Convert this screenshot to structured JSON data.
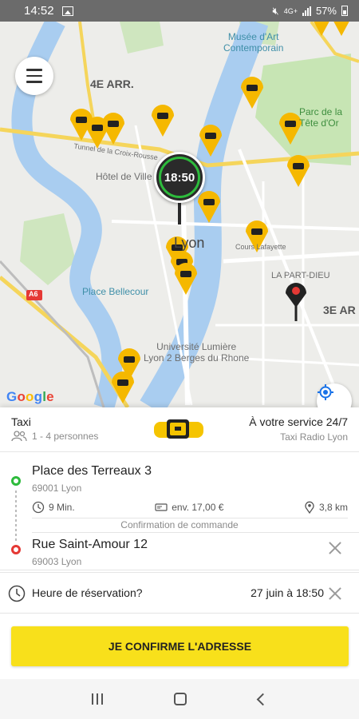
{
  "status_bar": {
    "time": "14:52",
    "battery": "57%",
    "network": "4G+"
  },
  "map": {
    "labels": {
      "arr4": "4E ARR.",
      "arr3": "3E AR",
      "musee": "Musée d'Art\nContemporain",
      "parc": "Parc de la\nTête d'Or",
      "lyon": "Lyon",
      "hotel": "Hôtel de Ville de Lyon",
      "bellecour": "Place Bellecour",
      "partdieu": "LA PART-DIEU",
      "univ": "Université Lumière\nLyon 2 Berges du Rhone",
      "lafayette": "Cours Lafayette",
      "a6": "A6",
      "croix": "Tunnel de la Croix-Rousse"
    },
    "pickup_time": "18:50",
    "attribution": "Google"
  },
  "vehicle": {
    "type": "Taxi",
    "capacity": "1 - 4 personnes",
    "service": "À votre service 24/7",
    "company": "Taxi Radio Lyon"
  },
  "route": {
    "origin": {
      "address": "Place des Terreaux 3",
      "city": "69001 Lyon"
    },
    "destination": {
      "address": "Rue Saint-Amour 12",
      "city": "69003 Lyon"
    },
    "duration": "9 Min.",
    "price": "env. 17,00 €",
    "distance": "3,8 km",
    "confirmation_note": "Confirmation de commande"
  },
  "reservation": {
    "label": "Heure de réservation?",
    "value": "27 juin à 18:50"
  },
  "cta": {
    "label": "JE CONFIRME L'ADRESSE"
  },
  "colors": {
    "accent": "#f8e01b",
    "pickup": "#2dbb3c",
    "destination": "#e53935",
    "river": "#a9cdf0"
  }
}
